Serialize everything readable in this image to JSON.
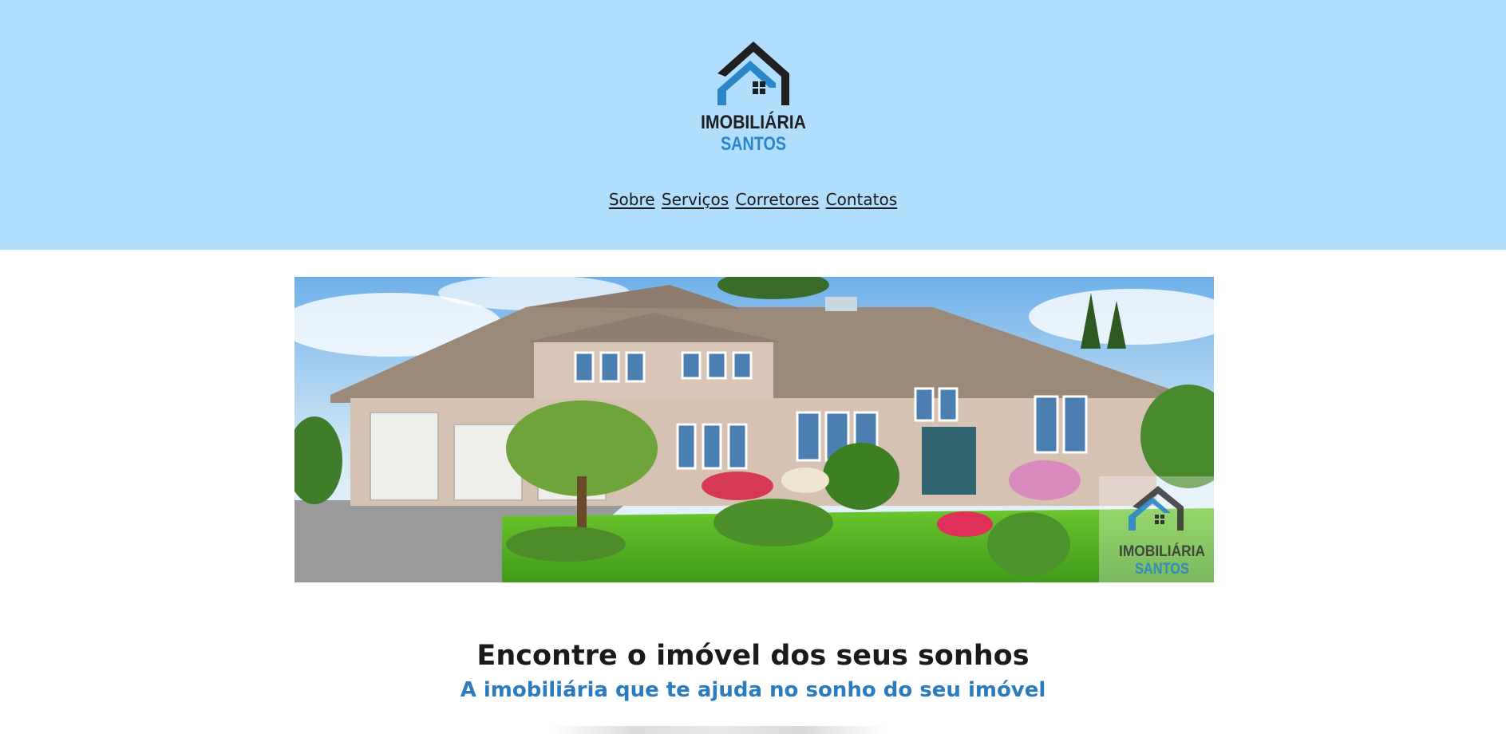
{
  "brand": {
    "name_line1": "IMOBILIÁRIA",
    "name_line2": "SANTOS",
    "colors": {
      "dark": "#1f1f1f",
      "blue": "#2b86c8",
      "header_bg": "#b0defc"
    }
  },
  "nav": {
    "items": [
      {
        "label": "Sobre"
      },
      {
        "label": "Serviços"
      },
      {
        "label": "Corretores"
      },
      {
        "label": "Contatos"
      }
    ]
  },
  "hero": {
    "watermark_line1": "IMOBILIÁRIA",
    "watermark_line2": "SANTOS"
  },
  "main": {
    "headline": "Encontre o imóvel dos seus sonhos",
    "subheadline": "A imobiliária que te ajuda no sonho do seu imóvel"
  }
}
